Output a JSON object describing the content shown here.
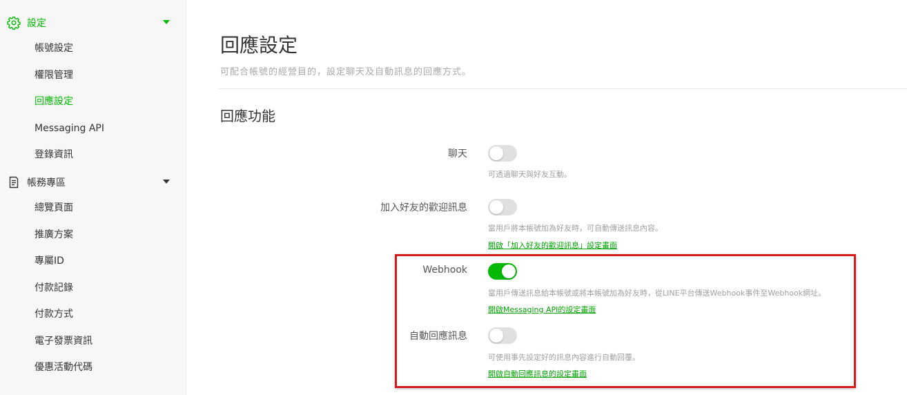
{
  "sidebar": {
    "settings": {
      "label": "設定",
      "icon": "gear-icon",
      "items": [
        {
          "label": "帳號設定"
        },
        {
          "label": "權限管理"
        },
        {
          "label": "回應設定"
        },
        {
          "label": "Messaging API"
        },
        {
          "label": "登錄資訊"
        }
      ]
    },
    "account": {
      "label": "帳務專區",
      "icon": "document-icon",
      "items": [
        {
          "label": "總覽頁面"
        },
        {
          "label": "推廣方案"
        },
        {
          "label": "專屬ID"
        },
        {
          "label": "付款記錄"
        },
        {
          "label": "付款方式"
        },
        {
          "label": "電子發票資訊"
        },
        {
          "label": "優惠活動代碼"
        }
      ]
    }
  },
  "main": {
    "title": "回應設定",
    "description": "可配合帳號的經營目的，設定聊天及自動訊息的回應方式。",
    "section_title": "回應功能",
    "rows": [
      {
        "label": "聊天",
        "enabled": false,
        "hint": "可透過聊天與好友互動。"
      },
      {
        "label": "加入好友的歡迎訊息",
        "enabled": false,
        "hint": "當用戶將本帳號加為好友時，可自動傳送訊息內容。",
        "link": "開啟「加入好友的歡迎訊息」設定畫面"
      },
      {
        "label": "Webhook",
        "enabled": true,
        "hint": "當用戶傳送訊息給本帳號或將本帳號加為好友時，從LINE平台傳送Webhook事件至Webhook網址。",
        "link": "開啟Messaging API的設定畫面"
      },
      {
        "label": "自動回應訊息",
        "enabled": false,
        "hint": "可使用事先設定好的訊息內容進行自動回覆。",
        "link": "開啟自動回應訊息的設定畫面"
      }
    ]
  },
  "colors": {
    "accent": "#00b900",
    "highlight_border": "#d21c1c",
    "toggle_off": "#e0e0e0"
  }
}
